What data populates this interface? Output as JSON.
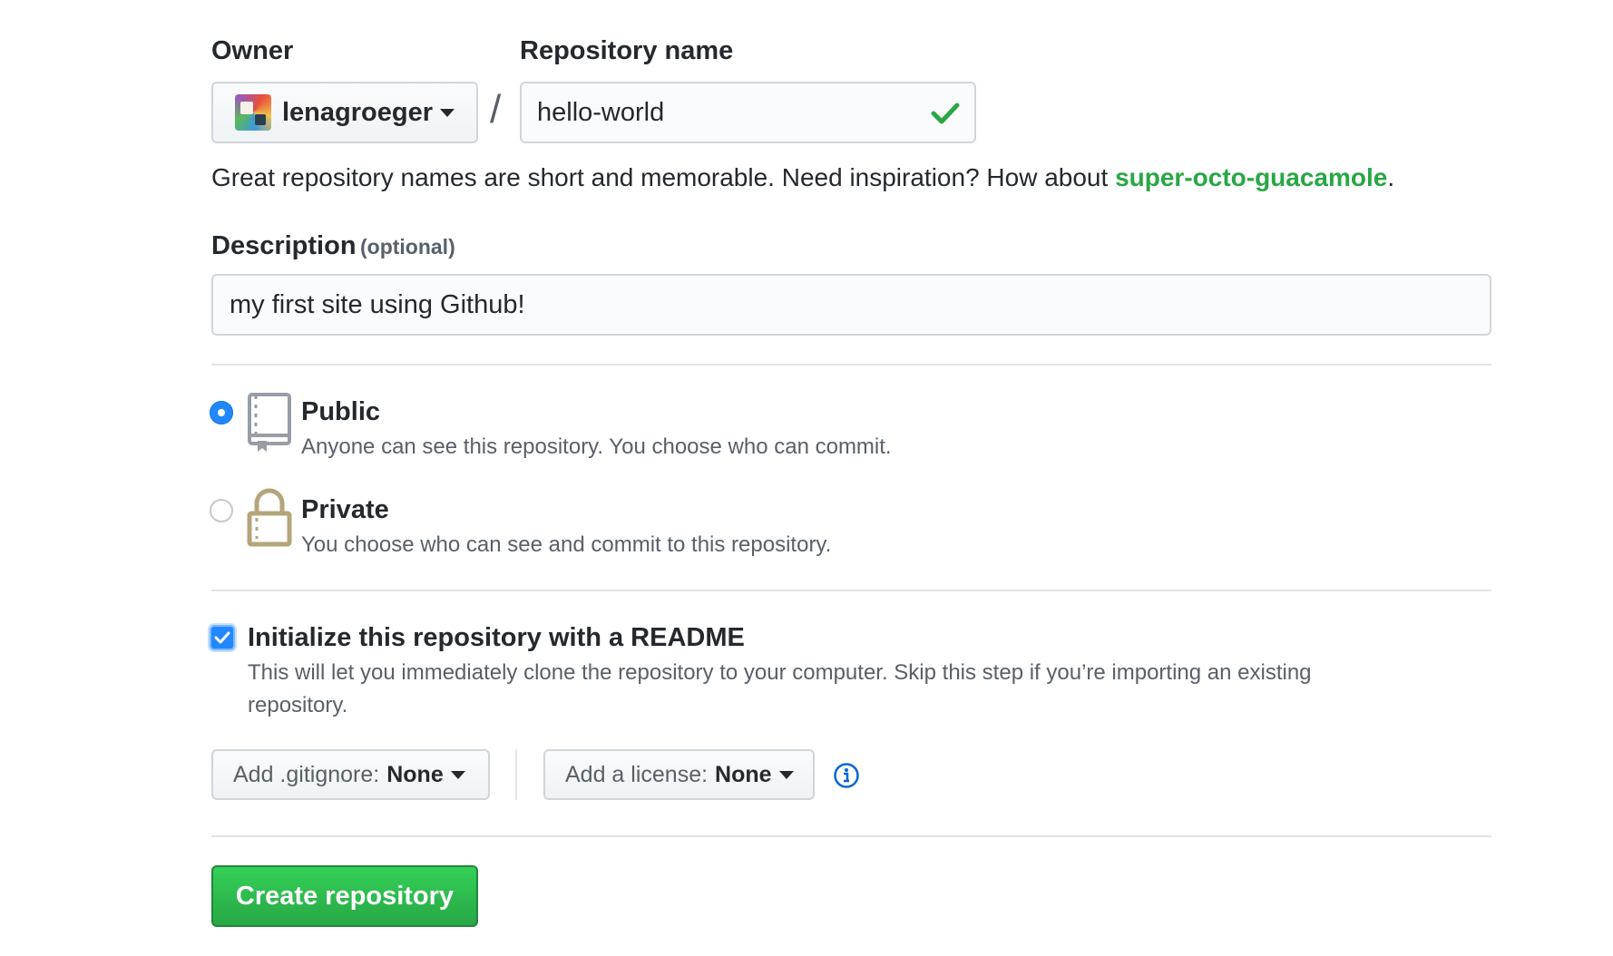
{
  "owner": {
    "label": "Owner",
    "value": "lenagroeger"
  },
  "repo": {
    "label": "Repository name",
    "separator": "/",
    "value": "hello-world"
  },
  "hint": {
    "text": "Great repository names are short and memorable. Need inspiration? How about ",
    "suggestion": "super-octo-guacamole",
    "end": "."
  },
  "description": {
    "label": "Description",
    "optional": "(optional)",
    "value": "my first site using Github!"
  },
  "visibility": {
    "public": {
      "title": "Public",
      "note": "Anyone can see this repository. You choose who can commit.",
      "selected": true
    },
    "private": {
      "title": "Private",
      "note": "You choose who can see and commit to this repository.",
      "selected": false
    }
  },
  "readme": {
    "title": "Initialize this repository with a README",
    "note_line1": "This will let you immediately clone the repository to your computer. Skip this step if you’re importing an existing",
    "note_line2": "repository.",
    "checked": true
  },
  "gitignore": {
    "prefix": "Add .gitignore:",
    "value": "None"
  },
  "license": {
    "prefix": "Add a license:",
    "value": "None"
  },
  "create_button": {
    "label": "Create repository"
  },
  "colors": {
    "accent_blue": "#2188ff",
    "suggestion_green": "#28a745",
    "button_green": "#28a745",
    "check_green": "#28a745"
  },
  "icons": [
    "chevron-down-icon",
    "check-icon",
    "repo-icon",
    "lock-icon",
    "info-icon",
    "avatar"
  ]
}
